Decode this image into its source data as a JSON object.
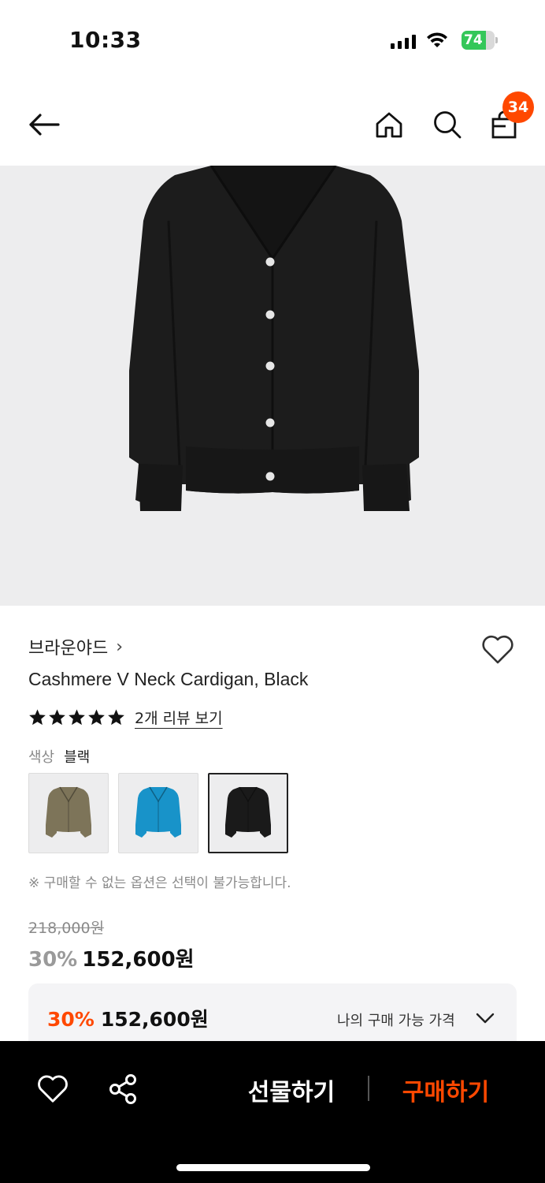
{
  "status_bar": {
    "time": "10:33",
    "battery_level": "74",
    "battery_percent": 74
  },
  "nav": {
    "bag_count": "34",
    "icons": [
      "arrow-left-icon",
      "home-icon",
      "search-icon",
      "shopping-bag-icon"
    ]
  },
  "product": {
    "brand": "브라운야드",
    "brand_chevron": "›",
    "title": "Cashmere V Neck Cardigan, Black",
    "rating_stars": 5,
    "review_link": "2개 리뷰 보기",
    "color_label": "색상",
    "color_value": "블랙",
    "swatches": [
      {
        "color": "#7d7459",
        "selected": false
      },
      {
        "color": "#1893c9",
        "selected": false
      },
      {
        "color": "#1a1a1a",
        "selected": true
      }
    ],
    "option_note": "※ 구매할 수 없는 옵션은 선택이 불가능합니다.",
    "original_price": "218,000원",
    "discount": "30%",
    "sale_price": "152,600원"
  },
  "my_price": {
    "discount": "30%",
    "price": "152,600원",
    "label": "나의 구매 가능 가격"
  },
  "bottom_bar": {
    "gift_label": "선물하기",
    "buy_label": "구매하기"
  },
  "colors": {
    "accent": "#ff4800",
    "image_bg": "#ededee"
  }
}
